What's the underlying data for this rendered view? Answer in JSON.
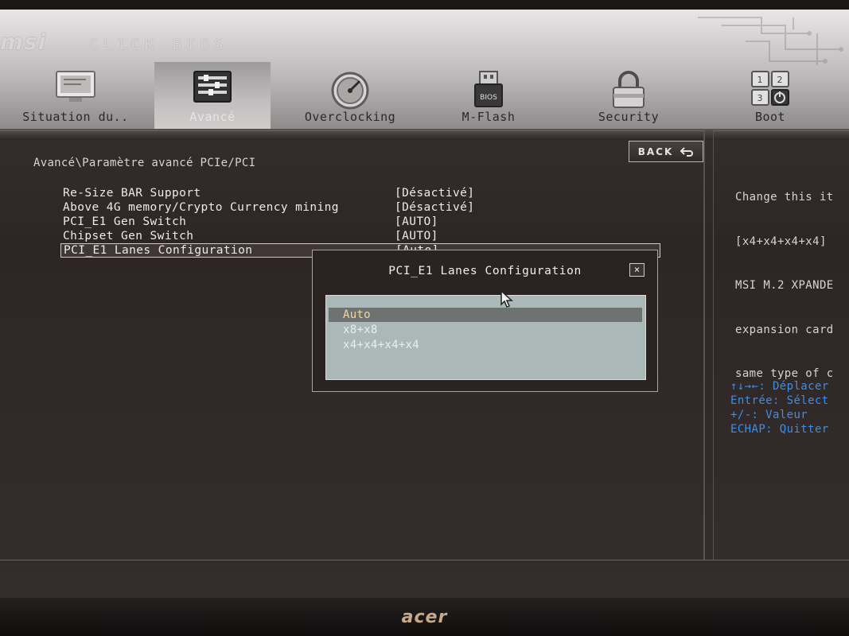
{
  "monitor": {
    "brand": "acer"
  },
  "header": {
    "logo": "msi",
    "logo_sub": "CLICK BIOS",
    "tabs": [
      {
        "label": "Situation du..",
        "icon": "monitor-icon"
      },
      {
        "label": "Avancé",
        "icon": "settings-panel-icon",
        "active": true
      },
      {
        "label": "Overclocking",
        "icon": "gauge-icon"
      },
      {
        "label": "M-Flash",
        "icon": "usb-bios-icon"
      },
      {
        "label": "Security",
        "icon": "padlock-icon"
      },
      {
        "label": "Boot",
        "icon": "boot-keys-icon"
      }
    ]
  },
  "main": {
    "back_label": "BACK",
    "breadcrumb": "Avancé\\Paramètre avancé PCIe/PCI",
    "rows": [
      {
        "label": "Re-Size BAR Support",
        "value": "[Désactivé]"
      },
      {
        "label": "Above 4G memory/Crypto Currency mining",
        "value": "[Désactivé]"
      },
      {
        "label": "PCI_E1 Gen Switch",
        "value": "[AUTO]"
      },
      {
        "label": "Chipset Gen Switch",
        "value": "[AUTO]"
      },
      {
        "label": "PCI_E1 Lanes Configuration",
        "value": "[Auto]",
        "selected": true
      }
    ]
  },
  "popup": {
    "title": "PCI_E1 Lanes Configuration",
    "close": "×",
    "options": [
      "Auto",
      "x8+x8",
      "x4+x4+x4+x4"
    ],
    "current": "Auto"
  },
  "side": {
    "help_lines": [
      "Change this it",
      "[x4+x4+x4+x4]",
      "MSI M.2 XPANDE",
      "expansion card",
      "same type of c"
    ],
    "keys": [
      "↑↓→←: Déplacer",
      "Entrée: Sélect",
      "+/-: Valeur",
      "ECHAP: Quitter"
    ]
  },
  "colors": {
    "accent": "#3d8ee6",
    "highlight_option": "#f1d79c"
  }
}
